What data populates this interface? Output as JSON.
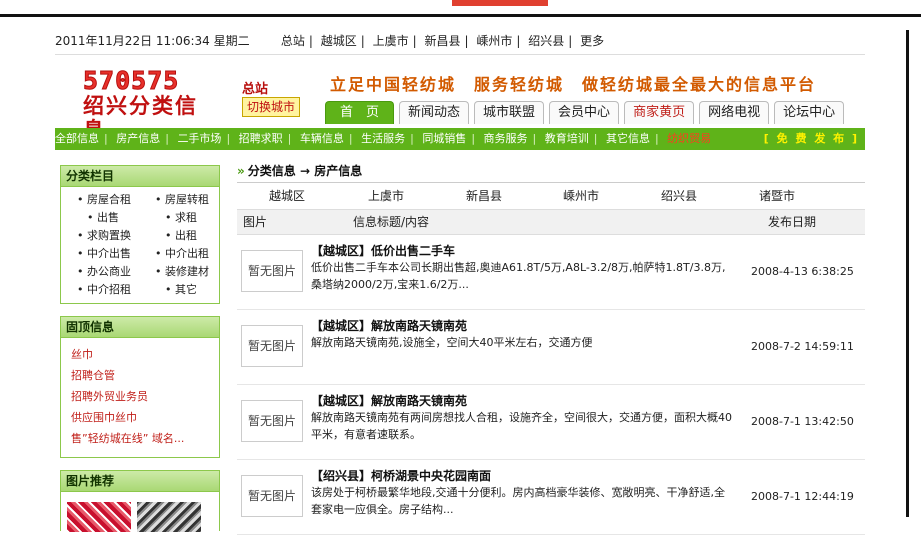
{
  "datetime": "2011年11月22日 11:06:34 星期二",
  "top_links": [
    "总站",
    "越城区",
    "上虞市",
    "新昌县",
    "嵊州市",
    "绍兴县",
    "更多"
  ],
  "logo": {
    "numbers": "570575",
    "brand": "绍兴分类信息"
  },
  "station": "总站",
  "switch_city": "切换城市",
  "slogan": "立足中国轻纺城　服务轻纺城　做轻纺城最全最大的信息平台",
  "tabs": [
    "首　页",
    "新闻动态",
    "城市联盟",
    "会员中心",
    "商家黄页",
    "网络电视",
    "论坛中心"
  ],
  "nav": [
    "全部信息",
    "房产信息",
    "二手市场",
    "招聘求职",
    "车辆信息",
    "生活服务",
    "同城销售",
    "商务服务",
    "教育培训",
    "其它信息",
    "纺织贸易"
  ],
  "free_post": "[ 免 费 发 布 ]",
  "sidebar": {
    "category_title": "分类栏目",
    "categories": [
      "• 房屋合租",
      "• 房屋转租",
      "• 出售",
      "• 求租",
      "• 求购置换",
      "• 出租",
      "• 中介出售",
      "• 中介出租",
      "• 办公商业",
      "• 装修建材",
      "• 中介招租",
      "• 其它"
    ],
    "fixed_title": "固顶信息",
    "fixed_items": [
      "丝巾",
      "招聘仓管",
      "招聘外贸业务员",
      "供应围巾丝巾",
      "售”轻纺城在线” 域名..."
    ],
    "pic_title": "图片推荐"
  },
  "breadcrumb": {
    "root": "分类信息",
    "arrow": "→",
    "current": "房产信息"
  },
  "districts": [
    "越城区",
    "上虞市",
    "新昌县",
    "嵊州市",
    "绍兴县",
    "诸暨市"
  ],
  "table_head": {
    "image": "图片",
    "title": "信息标题/内容",
    "date": "发布日期"
  },
  "no_image": "暂无图片",
  "listings": [
    {
      "title": "【越城区】低价出售二手车",
      "desc": "低价出售二手车本公司长期出售超,奥迪A61.8T/5万,A8L-3.2/8万,帕萨特1.8T/3.8万,桑塔纳2000/2万,宝来1.6/2万...",
      "date": "2008-4-13 6:38:25"
    },
    {
      "title": "【越城区】解放南路天镜南苑",
      "desc": "解放南路天镜南苑,设施全，空间大40平米左右，交通方便",
      "date": "2008-7-2 14:59:11"
    },
    {
      "title": "【越城区】解放南路天镜南苑",
      "desc": "解放南路天镜南苑有两间房想找人合租，设施齐全，空间很大，交通方便，面积大概40平米，有意者速联系。",
      "date": "2008-7-1 13:42:50"
    },
    {
      "title": "【绍兴县】柯桥湖景中央花园南面",
      "desc": "该房处于柯桥最繁华地段,交通十分便利。房内高档豪华装修、宽敞明亮、干净舒适,全套家电一应俱全。房子结构...",
      "date": "2008-7-1 12:44:19"
    }
  ],
  "colors": {
    "green": "#5fb319",
    "red": "#c0201a",
    "orange": "#d25a00"
  }
}
